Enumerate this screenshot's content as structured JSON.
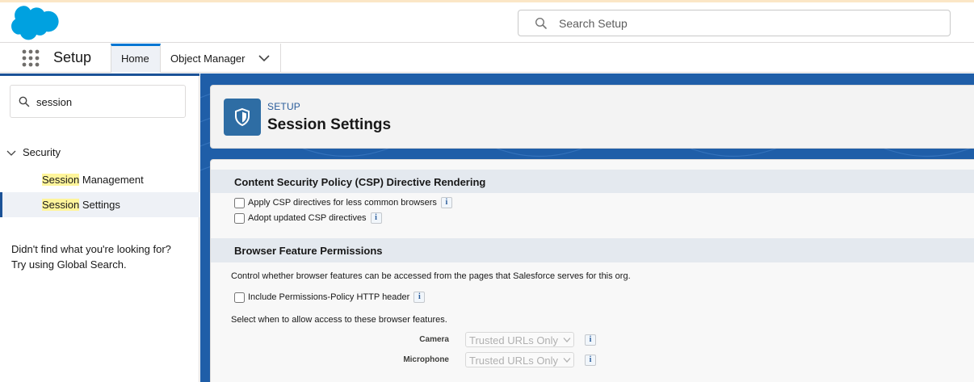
{
  "header": {
    "search_placeholder": "Search Setup"
  },
  "nav": {
    "app_name": "Setup",
    "tabs": [
      {
        "label": "Home",
        "active": true
      },
      {
        "label": "Object Manager",
        "active": false
      }
    ]
  },
  "sidebar": {
    "quick_find_value": "session",
    "tree": {
      "group": "Security",
      "items": [
        {
          "highlight": "Session",
          "rest": " Management",
          "active": false
        },
        {
          "highlight": "Session",
          "rest": " Settings",
          "active": true
        }
      ]
    },
    "not_found_line1": "Didn't find what you're looking for?",
    "not_found_line2": "Try using Global Search."
  },
  "page_header": {
    "eyebrow": "SETUP",
    "title": "Session Settings"
  },
  "sections": {
    "csp": {
      "title": "Content Security Policy (CSP) Directive Rendering",
      "options": [
        {
          "label": "Apply CSP directives for less common browsers",
          "checked": false
        },
        {
          "label": "Adopt updated CSP directives",
          "checked": false
        }
      ]
    },
    "browser": {
      "title": "Browser Feature Permissions",
      "description": "Control whether browser features can be accessed from the pages that Salesforce serves for this org.",
      "header_option": {
        "label": "Include Permissions-Policy HTTP header",
        "checked": false
      },
      "select_prompt": "Select when to allow access to these browser features.",
      "features": [
        {
          "label": "Camera",
          "value": "Trusted URLs Only"
        },
        {
          "label": "Microphone",
          "value": "Trusted URLs Only"
        }
      ]
    }
  },
  "info_glyph": "i",
  "colors": {
    "brand_blue": "#00a1e0",
    "content_bg": "#1f5ea8",
    "highlight": "#fff59b"
  }
}
